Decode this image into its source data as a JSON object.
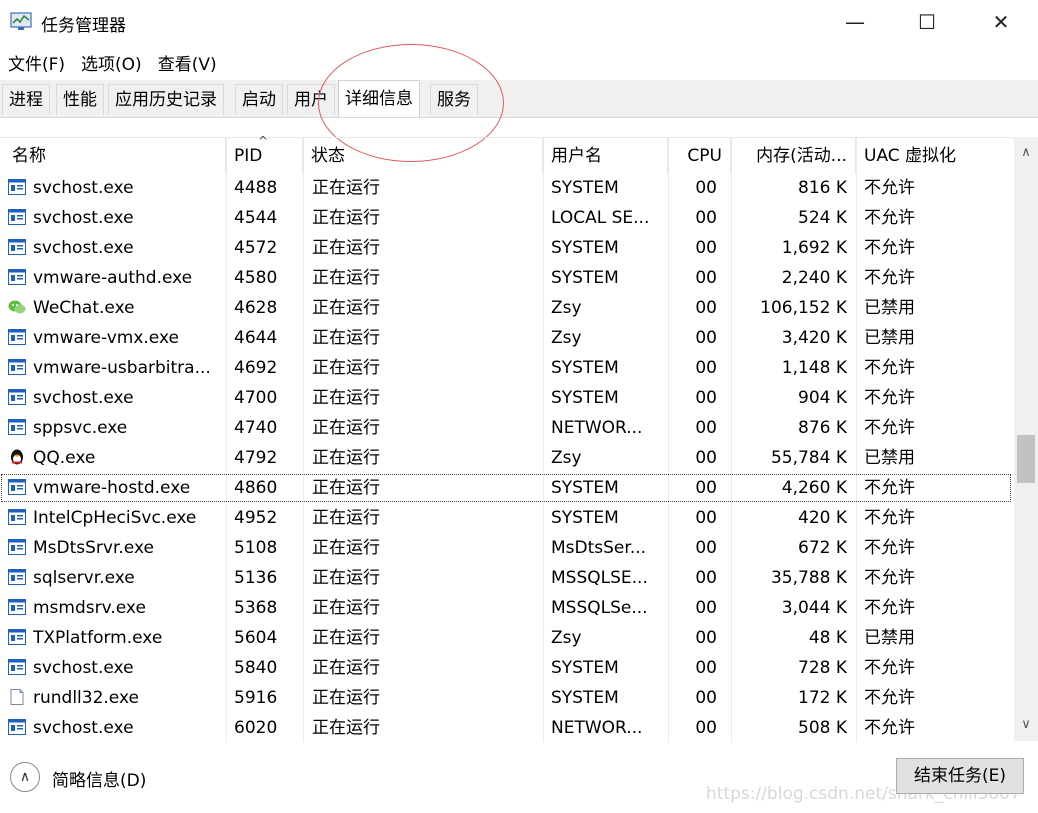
{
  "window": {
    "title": "任务管理器",
    "minimize": "—",
    "maximize": "☐",
    "close": "✕"
  },
  "menu": [
    "文件(F)",
    "选项(O)",
    "查看(V)"
  ],
  "tabs": [
    "进程",
    "性能",
    "应用历史记录",
    "启动",
    "用户",
    "详细信息",
    "服务"
  ],
  "active_tab": "详细信息",
  "columns": {
    "name": "名称",
    "pid": "PID",
    "status": "状态",
    "user": "用户名",
    "cpu": "CPU",
    "memory": "内存(活动...",
    "uac": "UAC 虚拟化"
  },
  "rows": [
    {
      "icon": "service-exe-icon",
      "name": "svchost.exe",
      "pid": "4488",
      "status": "正在运行",
      "user": "SYSTEM",
      "cpu": "00",
      "memory": "816 K",
      "uac": "不允许"
    },
    {
      "icon": "service-exe-icon",
      "name": "svchost.exe",
      "pid": "4544",
      "status": "正在运行",
      "user": "LOCAL SE...",
      "cpu": "00",
      "memory": "524 K",
      "uac": "不允许"
    },
    {
      "icon": "service-exe-icon",
      "name": "svchost.exe",
      "pid": "4572",
      "status": "正在运行",
      "user": "SYSTEM",
      "cpu": "00",
      "memory": "1,692 K",
      "uac": "不允许"
    },
    {
      "icon": "service-exe-icon",
      "name": "vmware-authd.exe",
      "pid": "4580",
      "status": "正在运行",
      "user": "SYSTEM",
      "cpu": "00",
      "memory": "2,240 K",
      "uac": "不允许"
    },
    {
      "icon": "wechat-icon",
      "name": "WeChat.exe",
      "pid": "4628",
      "status": "正在运行",
      "user": "Zsy",
      "cpu": "00",
      "memory": "106,152 K",
      "uac": "已禁用"
    },
    {
      "icon": "service-exe-icon",
      "name": "vmware-vmx.exe",
      "pid": "4644",
      "status": "正在运行",
      "user": "Zsy",
      "cpu": "00",
      "memory": "3,420 K",
      "uac": "已禁用"
    },
    {
      "icon": "service-exe-icon",
      "name": "vmware-usbarbitra...",
      "pid": "4692",
      "status": "正在运行",
      "user": "SYSTEM",
      "cpu": "00",
      "memory": "1,148 K",
      "uac": "不允许"
    },
    {
      "icon": "service-exe-icon",
      "name": "svchost.exe",
      "pid": "4700",
      "status": "正在运行",
      "user": "SYSTEM",
      "cpu": "00",
      "memory": "904 K",
      "uac": "不允许"
    },
    {
      "icon": "service-exe-icon",
      "name": "sppsvc.exe",
      "pid": "4740",
      "status": "正在运行",
      "user": "NETWOR...",
      "cpu": "00",
      "memory": "876 K",
      "uac": "不允许"
    },
    {
      "icon": "qq-penguin-icon",
      "name": "QQ.exe",
      "pid": "4792",
      "status": "正在运行",
      "user": "Zsy",
      "cpu": "00",
      "memory": "55,784 K",
      "uac": "已禁用"
    },
    {
      "icon": "service-exe-icon",
      "name": "vmware-hostd.exe",
      "pid": "4860",
      "status": "正在运行",
      "user": "SYSTEM",
      "cpu": "00",
      "memory": "4,260 K",
      "uac": "不允许"
    },
    {
      "icon": "service-exe-icon",
      "name": "IntelCpHeciSvc.exe",
      "pid": "4952",
      "status": "正在运行",
      "user": "SYSTEM",
      "cpu": "00",
      "memory": "420 K",
      "uac": "不允许"
    },
    {
      "icon": "service-exe-icon",
      "name": "MsDtsSrvr.exe",
      "pid": "5108",
      "status": "正在运行",
      "user": "MsDtsSer...",
      "cpu": "00",
      "memory": "672 K",
      "uac": "不允许"
    },
    {
      "icon": "service-exe-icon",
      "name": "sqlservr.exe",
      "pid": "5136",
      "status": "正在运行",
      "user": "MSSQLSE...",
      "cpu": "00",
      "memory": "35,788 K",
      "uac": "不允许"
    },
    {
      "icon": "service-exe-icon",
      "name": "msmdsrv.exe",
      "pid": "5368",
      "status": "正在运行",
      "user": "MSSQLSe...",
      "cpu": "00",
      "memory": "3,044 K",
      "uac": "不允许"
    },
    {
      "icon": "service-exe-icon",
      "name": "TXPlatform.exe",
      "pid": "5604",
      "status": "正在运行",
      "user": "Zsy",
      "cpu": "00",
      "memory": "48 K",
      "uac": "已禁用"
    },
    {
      "icon": "service-exe-icon",
      "name": "svchost.exe",
      "pid": "5840",
      "status": "正在运行",
      "user": "SYSTEM",
      "cpu": "00",
      "memory": "728 K",
      "uac": "不允许"
    },
    {
      "icon": "blank-document-icon",
      "name": "rundll32.exe",
      "pid": "5916",
      "status": "正在运行",
      "user": "SYSTEM",
      "cpu": "00",
      "memory": "172 K",
      "uac": "不允许"
    },
    {
      "icon": "service-exe-icon",
      "name": "svchost.exe",
      "pid": "6020",
      "status": "正在运行",
      "user": "NETWOR...",
      "cpu": "00",
      "memory": "508 K",
      "uac": "不允许"
    }
  ],
  "focused_row": "4860",
  "footer": {
    "brief_label": "简略信息(D)",
    "end_task_label": "结束任务(E)"
  },
  "watermark": "https://blog.csdn.net/shark_chili3007",
  "colors": {
    "annotation_circle": "#e05a5a",
    "service_icon_blue": "#1f5fbf"
  }
}
